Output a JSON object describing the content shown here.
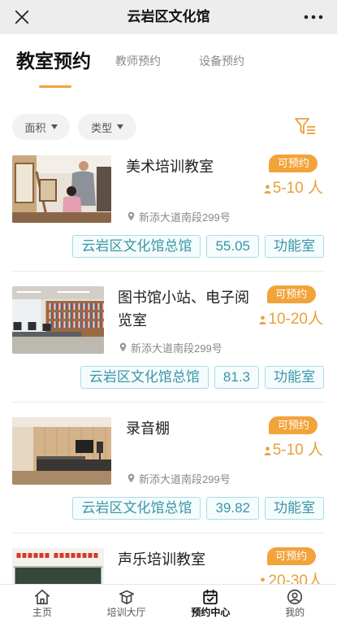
{
  "header": {
    "title": "云岩区文化馆",
    "close_icon": "close-icon",
    "more_icon": "more-icon"
  },
  "tabs": [
    {
      "label": "教室预约",
      "active": true
    },
    {
      "label": "教师预约",
      "active": false
    },
    {
      "label": "设备预约",
      "active": false
    }
  ],
  "filters": [
    {
      "label": "面积",
      "icon": "chevron-down-icon"
    },
    {
      "label": "类型",
      "icon": "chevron-down-icon"
    }
  ],
  "filter_button": {
    "icon": "filter-icon"
  },
  "rooms": [
    {
      "title": "美术培训教室",
      "status": "可预约",
      "capacity": "5-10 人",
      "address": "新添大道南段299号",
      "venue": "云岩区文化馆总馆",
      "area": "55.05",
      "category": "功能室"
    },
    {
      "title": "图书馆小站、电子阅览室",
      "status": "可预约",
      "capacity": "10-20人",
      "address": "新添大道南段299号",
      "venue": "云岩区文化馆总馆",
      "area": "81.3",
      "category": "功能室"
    },
    {
      "title": "录音棚",
      "status": "可预约",
      "capacity": "5-10 人",
      "address": "新添大道南段299号",
      "venue": "云岩区文化馆总馆",
      "area": "39.82",
      "category": "功能室"
    },
    {
      "title": "声乐培训教室",
      "status": "可预约",
      "capacity": "20-30人"
    }
  ],
  "bottom_nav": [
    {
      "label": "主页",
      "icon": "home-icon",
      "active": false
    },
    {
      "label": "培训大厅",
      "icon": "training-hall-icon",
      "active": false
    },
    {
      "label": "预约中心",
      "icon": "calendar-icon",
      "active": true
    },
    {
      "label": "我的",
      "icon": "user-icon",
      "active": false
    }
  ],
  "icons": {
    "location": "location-pin-icon",
    "capacity": "person-icon"
  },
  "colors": {
    "accent": "#F2A33A",
    "capacity_text": "#E9A03C",
    "tag_text": "#3A95A8",
    "tag_border": "#A8DDE6",
    "topbar_bg": "#EDEDED"
  }
}
